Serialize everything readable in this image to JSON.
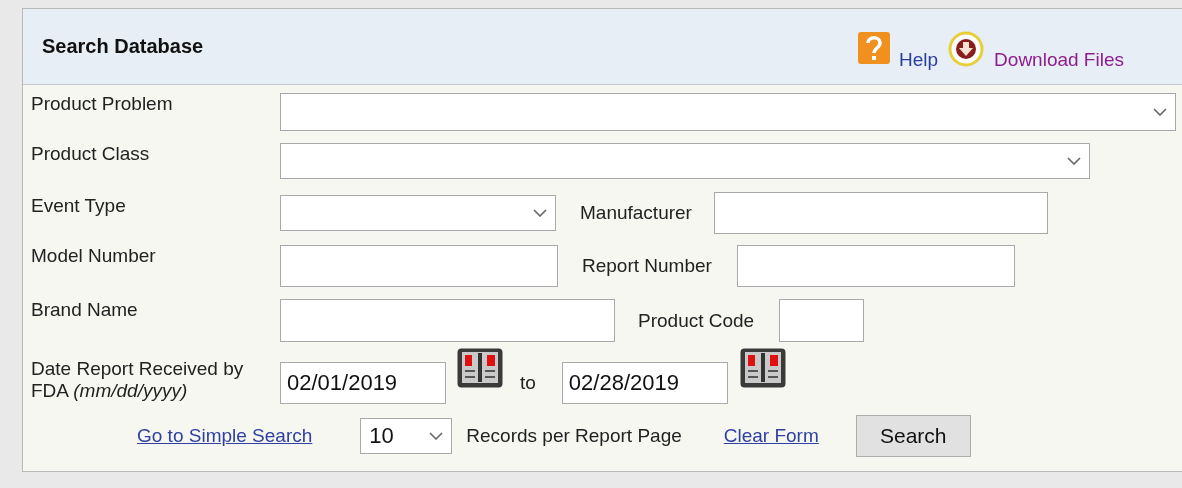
{
  "header": {
    "title": "Search Database",
    "links": [
      {
        "kind": "help",
        "label": "Help"
      },
      {
        "kind": "download",
        "label": "Download Files"
      }
    ]
  },
  "form": {
    "product_problem": {
      "label": "Product Problem"
    },
    "product_class": {
      "label": "Product Class"
    },
    "event_type": {
      "label": "Event Type"
    },
    "manufacturer": {
      "label": "Manufacturer"
    },
    "model_number": {
      "label": "Model Number"
    },
    "report_number": {
      "label": "Report Number"
    },
    "brand_name": {
      "label": "Brand Name"
    },
    "product_code": {
      "label": "Product Code"
    },
    "date_received": {
      "label": "Date Report Received by FDA *(mm/dd/yyyy)*",
      "from": "02/01/2019",
      "separator": "to",
      "to": "02/28/2019"
    }
  },
  "footer": {
    "simple_search_link": "Go to Simple Search",
    "records_per_page": {
      "value": "10",
      "label": "Records per Report Page"
    },
    "clear_link": "Clear Form",
    "search_button": "Search"
  }
}
